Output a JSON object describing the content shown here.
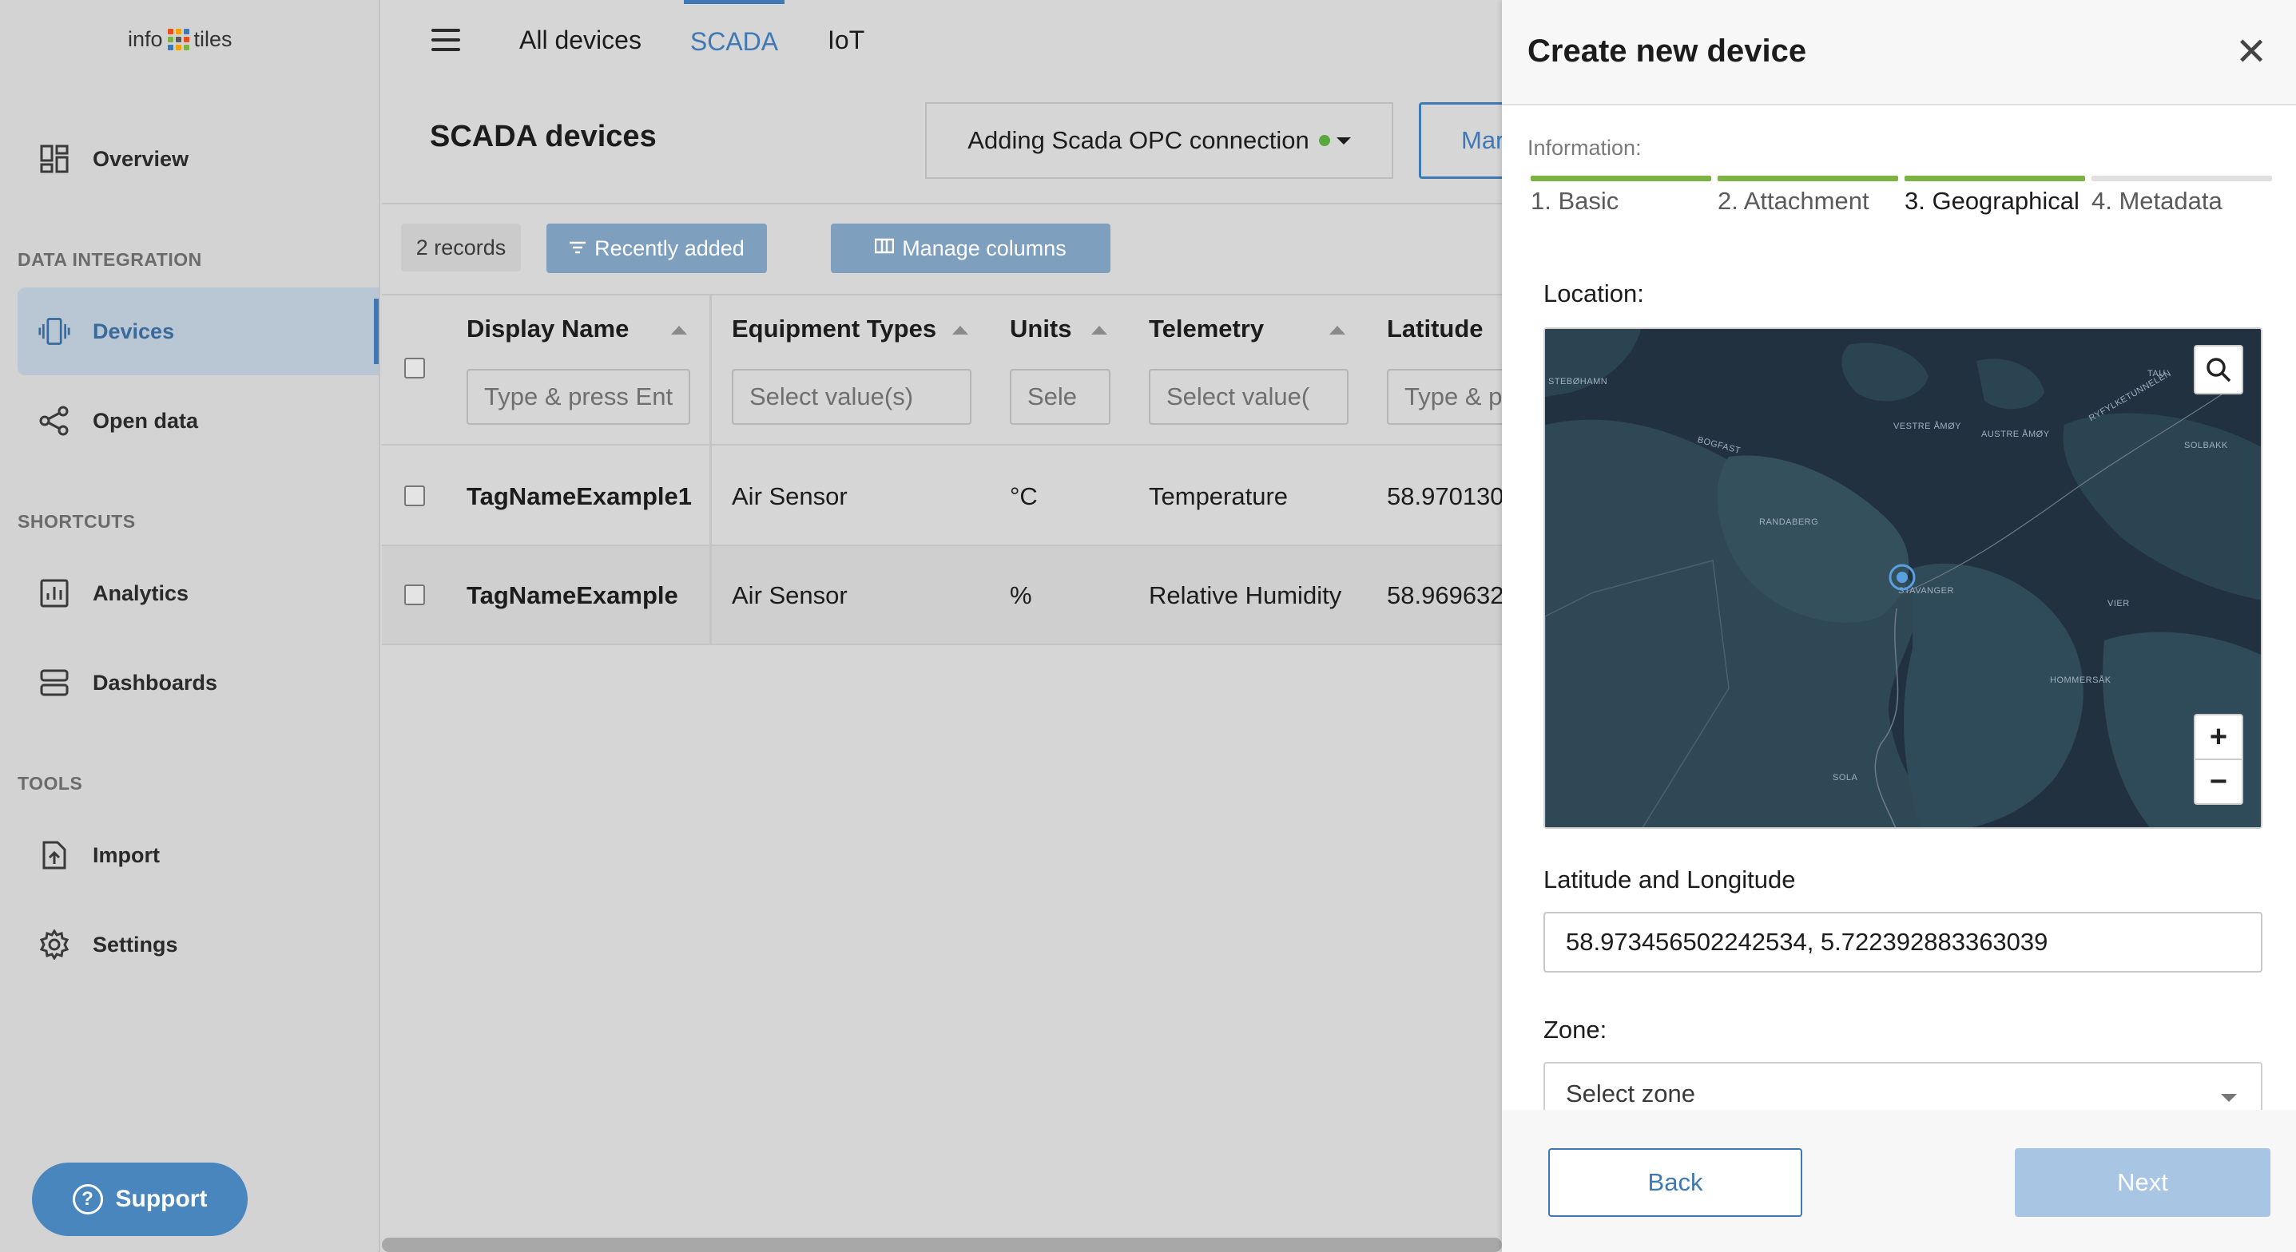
{
  "sidebar": {
    "logo_left": "info",
    "logo_right": "tiles",
    "overview": "Overview",
    "section_data_integration": "DATA INTEGRATION",
    "devices": "Devices",
    "open_data": "Open data",
    "section_shortcuts": "SHORTCUTS",
    "analytics": "Analytics",
    "dashboards": "Dashboards",
    "section_tools": "TOOLS",
    "import": "Import",
    "settings": "Settings",
    "support": "Support"
  },
  "topnav": {
    "tabs": [
      "All devices",
      "SCADA",
      "IoT"
    ],
    "active_tab": "SCADA"
  },
  "main": {
    "title": "SCADA devices",
    "connection_dropdown": "Adding Scada OPC connection",
    "manage_button": "Mar",
    "records": "2 records",
    "recently_added": "Recently added",
    "manage_columns": "Manage columns"
  },
  "table": {
    "columns": [
      {
        "label": "Display Name",
        "filter": "Type & press Ent"
      },
      {
        "label": "Equipment Types",
        "filter": "Select value(s)"
      },
      {
        "label": "Units",
        "filter": "Sele"
      },
      {
        "label": "Telemetry",
        "filter": "Select value("
      },
      {
        "label": "Latitude",
        "filter": "Type & p"
      }
    ],
    "rows": [
      {
        "name": "TagNameExample1",
        "equipment": "Air Sensor",
        "unit": "°C",
        "telemetry": "Temperature",
        "latitude": "58.970130"
      },
      {
        "name": "TagNameExample",
        "equipment": "Air Sensor",
        "unit": "%",
        "telemetry": "Relative Humidity",
        "latitude": "58.969632"
      }
    ]
  },
  "panel": {
    "title": "Create new device",
    "info_label": "Information:",
    "steps": [
      {
        "label": "1. Basic",
        "done": true
      },
      {
        "label": "2. Attachment",
        "done": true
      },
      {
        "label": "3. Geographical",
        "done": true
      },
      {
        "label": "4. Metadata",
        "done": false
      }
    ],
    "location_label": "Location:",
    "map_labels": [
      "STEBØHAMN",
      "RANDABERG",
      "STAVANGER",
      "HOMMERSÅK",
      "SOLA",
      "VIER",
      "TAU",
      "SOLBAKK",
      "VESTRE ÅMØY",
      "AUSTRE ÅMØY",
      "RYFYLKETUNNELEN",
      "BOGFAST"
    ],
    "zoom_in": "+",
    "zoom_out": "−",
    "latlng_label": "Latitude and Longitude",
    "latlng_value": "58.973456502242534, 5.722392883363039",
    "zone_label": "Zone:",
    "zone_placeholder": "Select zone",
    "back": "Back",
    "next": "Next"
  },
  "colors": {
    "accent": "#3f79b5",
    "step_done": "#7cb342",
    "step_pending": "#e0e0e0",
    "status_dot": "#5aa83c"
  }
}
